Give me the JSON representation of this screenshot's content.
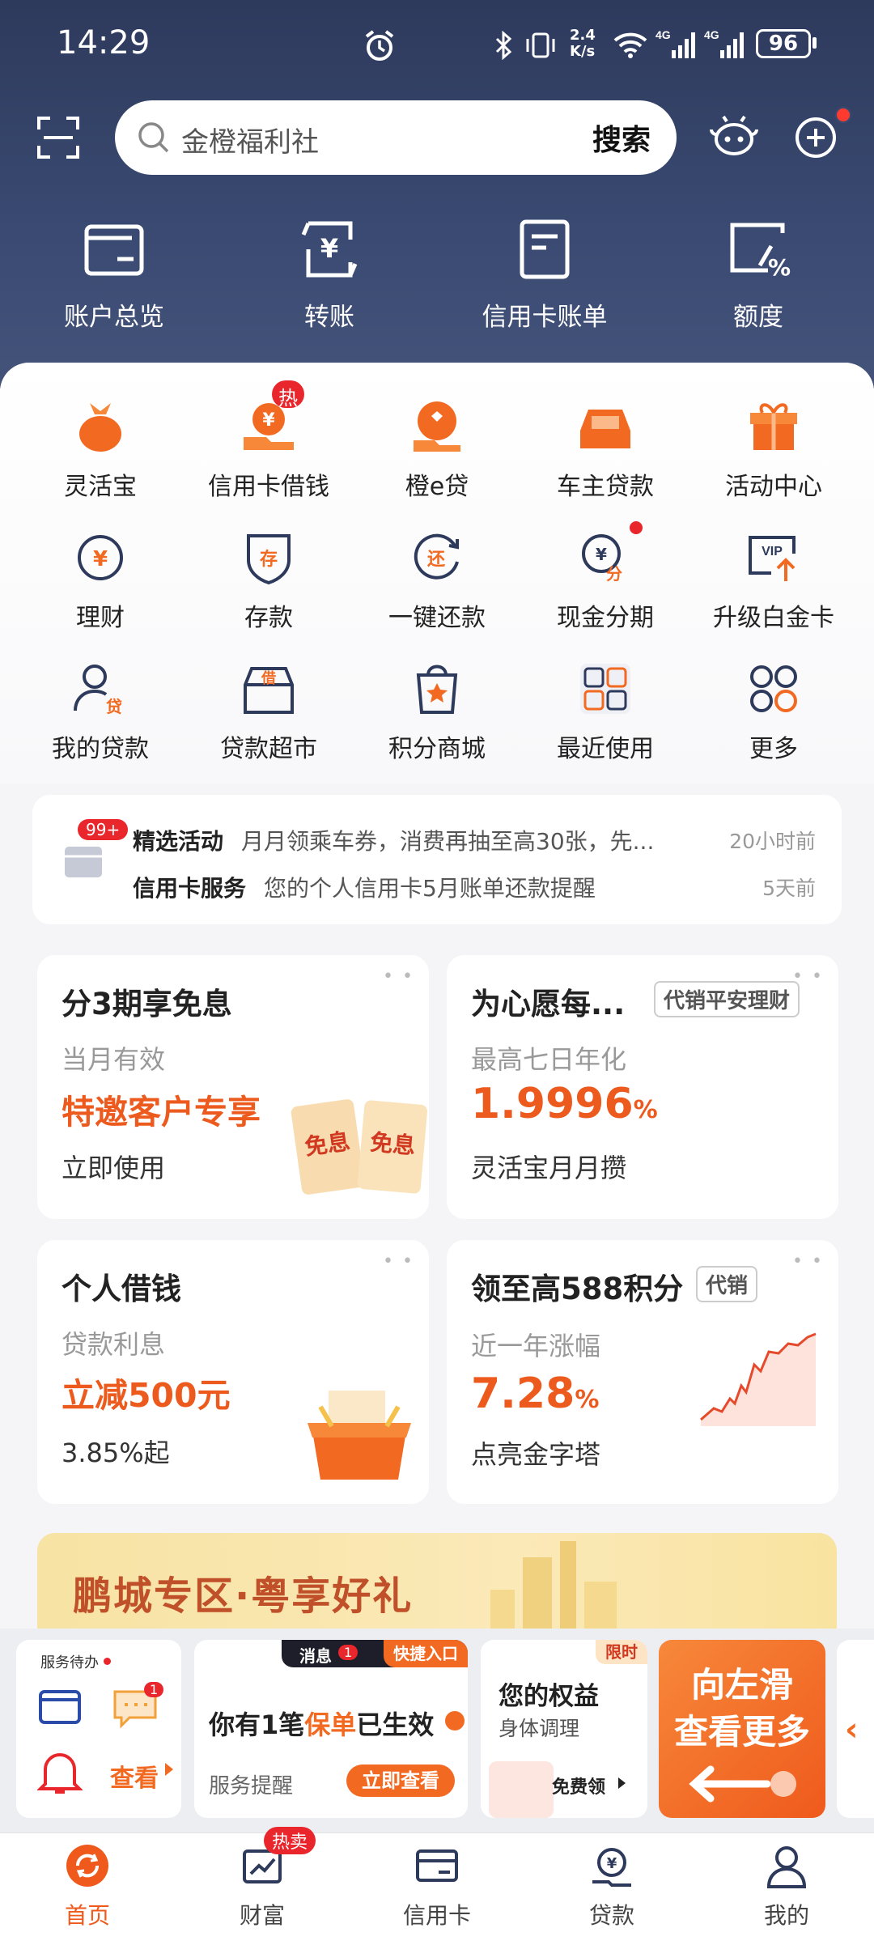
{
  "status_bar": {
    "time": "14:29",
    "speed": "2.4\nK/s",
    "battery": "96"
  },
  "search": {
    "placeholder": "金橙福利社",
    "button": "搜索"
  },
  "top_nav": [
    {
      "label": "账户总览",
      "icon": "wallet-icon"
    },
    {
      "label": "转账",
      "icon": "transfer-icon"
    },
    {
      "label": "信用卡账单",
      "icon": "bill-icon"
    },
    {
      "label": "额度",
      "icon": "quota-icon"
    }
  ],
  "grid": [
    {
      "label": "灵活宝",
      "icon": "money-bag-icon"
    },
    {
      "label": "信用卡借钱",
      "icon": "hand-money-icon",
      "badge": "热"
    },
    {
      "label": "橙e贷",
      "icon": "loan-hand-icon"
    },
    {
      "label": "车主贷款",
      "icon": "car-icon"
    },
    {
      "label": "活动中心",
      "icon": "gift-icon"
    },
    {
      "label": "理财",
      "icon": "yuan-circle-icon"
    },
    {
      "label": "存款",
      "icon": "deposit-icon"
    },
    {
      "label": "一键还款",
      "icon": "repay-icon"
    },
    {
      "label": "现金分期",
      "icon": "installment-icon"
    },
    {
      "label": "升级白金卡",
      "icon": "vip-card-icon"
    },
    {
      "label": "我的贷款",
      "icon": "user-loan-icon"
    },
    {
      "label": "贷款超市",
      "icon": "loan-store-icon"
    },
    {
      "label": "积分商城",
      "icon": "points-mall-icon"
    },
    {
      "label": "最近使用",
      "icon": "recent-apps-icon"
    },
    {
      "label": "更多",
      "icon": "more-grid-icon"
    }
  ],
  "notice": {
    "badge": "99+",
    "rows": [
      {
        "title": "精选活动",
        "text": "月月领乘车券，消费再抽至高30张，先...",
        "time": "20小时前"
      },
      {
        "title": "信用卡服务",
        "text": "您的个人信用卡5月账单还款提醒",
        "time": "5天前"
      }
    ]
  },
  "cards": [
    {
      "title": "分3期享免息",
      "sub": "当月有效",
      "highlight": "特邀客户专享",
      "foot": "立即使用",
      "img_text_1": "免息",
      "img_text_2": "免息"
    },
    {
      "title": "为心愿每...",
      "tag": "代销平安理财",
      "sub": "最高七日年化",
      "highlight": "1.9996",
      "unit": "%",
      "foot": "灵活宝月月攒"
    },
    {
      "title": "个人借钱",
      "sub": "贷款利息",
      "highlight": "立减500元",
      "foot": "3.85%起"
    },
    {
      "title": "领至高588积分",
      "tag": "代销",
      "sub": "近一年涨幅",
      "highlight": "7.28",
      "unit": "%",
      "foot": "点亮金字塔"
    }
  ],
  "banner": {
    "text": "鹏城专区·粤享好礼"
  },
  "service": {
    "label": "服务待办",
    "msg_badge": "1",
    "view": "查看",
    "msg_tab": "消息",
    "msg_tab_count": "1",
    "shortcut_tab": "快捷入口",
    "policy_pre": "你有1笔",
    "policy_hl": "保单",
    "policy_post": "已生效",
    "reminder": "服务提醒",
    "reminder_btn": "立即查看",
    "limited": "限时",
    "rights_title": "您的权益",
    "rights_sub": "身体调理",
    "rights_btn": "免费领",
    "swipe_1": "向左滑",
    "swipe_2": "查看更多"
  },
  "tabbar": [
    {
      "label": "首页",
      "active": true
    },
    {
      "label": "财富",
      "badge": "热卖"
    },
    {
      "label": "信用卡"
    },
    {
      "label": "贷款"
    },
    {
      "label": "我的"
    }
  ],
  "colors": {
    "accent": "#ec5a1e",
    "header": "#354468",
    "badge": "#e8262b"
  }
}
